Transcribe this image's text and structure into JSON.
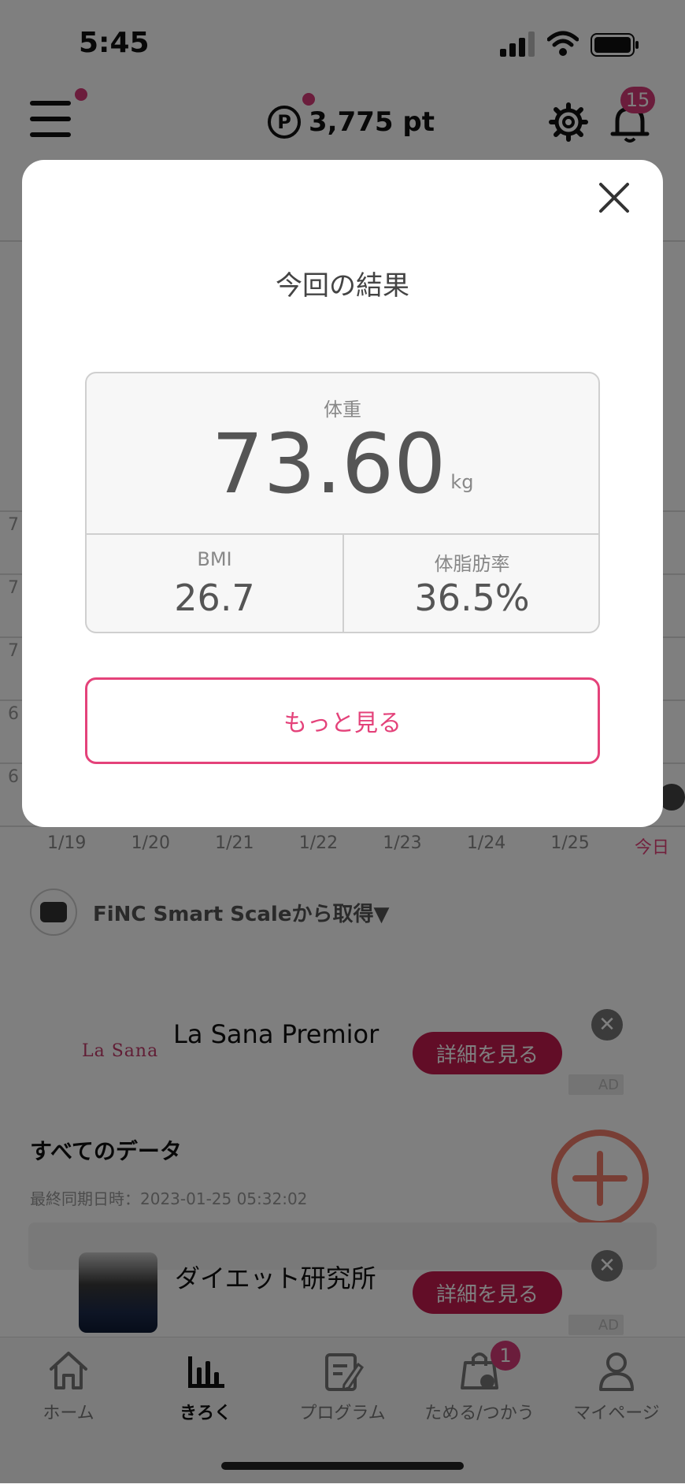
{
  "status_bar": {
    "time": "5:45"
  },
  "header": {
    "points": "3,775 pt",
    "points_symbol": "P",
    "notification_count": "15"
  },
  "chart_background": {
    "y_ticks": [
      "7",
      "7",
      "7",
      "6",
      "6"
    ],
    "x_labels": [
      "1/19",
      "1/20",
      "1/21",
      "1/22",
      "1/23",
      "1/24",
      "1/25",
      "今日"
    ]
  },
  "source": {
    "label": "FiNC Smart Scaleから取得▼"
  },
  "ads": [
    {
      "logo": "La Sana",
      "title": "La Sana Premior",
      "button": "詳細を見る",
      "tag": "AD",
      "close": "✕"
    },
    {
      "title": "ダイエット研究所",
      "button": "詳細を見る",
      "tag": "AD",
      "close": "✕"
    }
  ],
  "all_data": {
    "title": "すべてのデータ",
    "sync": "最終同期日時：2023-01-25 05:32:02"
  },
  "bottom_nav": {
    "items": [
      {
        "label": "ホーム",
        "icon": "home-icon"
      },
      {
        "label": "きろく",
        "icon": "chart-icon"
      },
      {
        "label": "プログラム",
        "icon": "program-icon"
      },
      {
        "label": "ためる/つかう",
        "icon": "shopping-bag-icon"
      },
      {
        "label": "マイページ",
        "icon": "person-icon"
      }
    ],
    "active": "きろく",
    "badge": "1"
  },
  "modal": {
    "title": "今回の結果",
    "weight": {
      "label": "体重",
      "value": "73.60",
      "unit": "kg"
    },
    "bmi": {
      "label": "BMI",
      "value": "26.7"
    },
    "body_fat": {
      "label": "体脂肪率",
      "value": "36.5%"
    },
    "more_button": "もっと見る"
  },
  "colors": {
    "accent": "#e4427a",
    "badge": "#d63a78",
    "ad_button": "#c41a4f",
    "fab": "#f07d6b"
  }
}
